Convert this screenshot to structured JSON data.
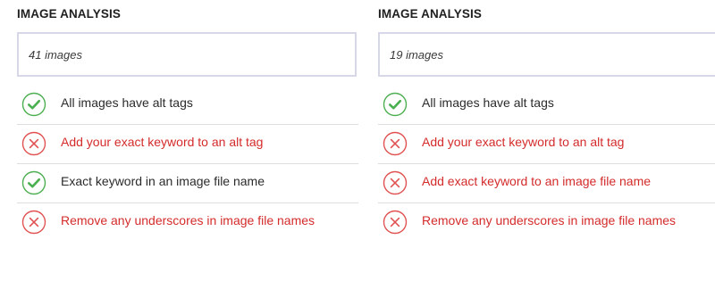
{
  "colors": {
    "pass": "#4caf50",
    "fail": "#e05252",
    "fail_text": "#d42b2b",
    "box_border": "#d6d8e8"
  },
  "panels": [
    {
      "title": "IMAGE ANALYSIS",
      "count_text": "41 images",
      "checks": [
        {
          "status": "pass",
          "icon": "check-circle-icon",
          "label": "All images have alt tags"
        },
        {
          "status": "fail",
          "icon": "x-circle-icon",
          "label": "Add your exact keyword to an alt tag"
        },
        {
          "status": "pass",
          "icon": "check-circle-icon",
          "label": "Exact keyword in an image file name"
        },
        {
          "status": "fail",
          "icon": "x-circle-icon",
          "label": "Remove any underscores in image file names"
        }
      ]
    },
    {
      "title": "IMAGE ANALYSIS",
      "count_text": "19 images",
      "checks": [
        {
          "status": "pass",
          "icon": "check-circle-icon",
          "label": "All images have alt tags"
        },
        {
          "status": "fail",
          "icon": "x-circle-icon",
          "label": "Add your exact keyword to an alt tag"
        },
        {
          "status": "fail",
          "icon": "x-circle-icon",
          "label": "Add exact keyword to an image file name"
        },
        {
          "status": "fail",
          "icon": "x-circle-icon",
          "label": "Remove any underscores in image file names"
        }
      ]
    }
  ]
}
